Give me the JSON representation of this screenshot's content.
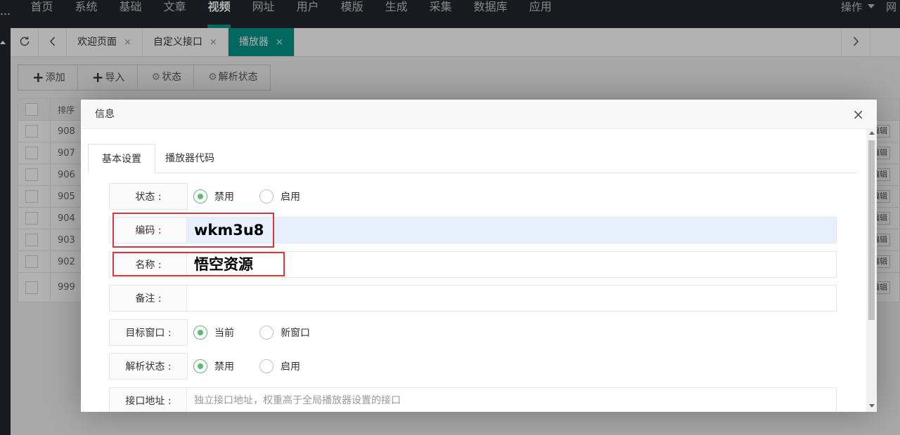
{
  "topnav": {
    "dots": "…",
    "items": [
      "首页",
      "系统",
      "基础",
      "文章",
      "视频",
      "网址",
      "用户",
      "模版",
      "生成",
      "采集",
      "数据库",
      "应用"
    ],
    "active": "视频",
    "actions": "操作",
    "net": "网"
  },
  "tabbar": {
    "tabs": [
      {
        "label": "欢迎页面",
        "close": "×"
      },
      {
        "label": "自定义接口",
        "close": "×"
      },
      {
        "label": "播放器",
        "close": "×"
      }
    ]
  },
  "toolbar": {
    "add": "添加",
    "import": "导入",
    "status": "状态",
    "parse_status": "解析状态"
  },
  "table": {
    "header_sort": "排序",
    "rows": [
      "908",
      "907",
      "906",
      "905",
      "904",
      "903",
      "902",
      "999"
    ],
    "edit_label": "编辑"
  },
  "modal": {
    "title": "信息",
    "close": "×",
    "tabs": [
      "基本设置",
      "播放器代码"
    ],
    "status": {
      "label": "状态 :",
      "options": [
        "禁用",
        "启用"
      ],
      "selected": "禁用"
    },
    "code": {
      "label": "编码 :",
      "value": "wkm3u8"
    },
    "name": {
      "label": "名称 :",
      "value": "悟空资源"
    },
    "remark": {
      "label": "备注 :",
      "value": ""
    },
    "target": {
      "label": "目标窗口 :",
      "options": [
        "当前",
        "新窗口"
      ],
      "selected": "当前"
    },
    "parse": {
      "label": "解析状态 :",
      "options": [
        "禁用",
        "启用"
      ],
      "selected": "禁用"
    },
    "api": {
      "label": "接口地址 :",
      "placeholder": "独立接口地址，权重高于全局播放器设置的接口"
    }
  },
  "colors": {
    "accent": "#009688",
    "radio_on": "#5fb878",
    "highlight": "#d9363e",
    "nav_bg": "#23262e"
  }
}
